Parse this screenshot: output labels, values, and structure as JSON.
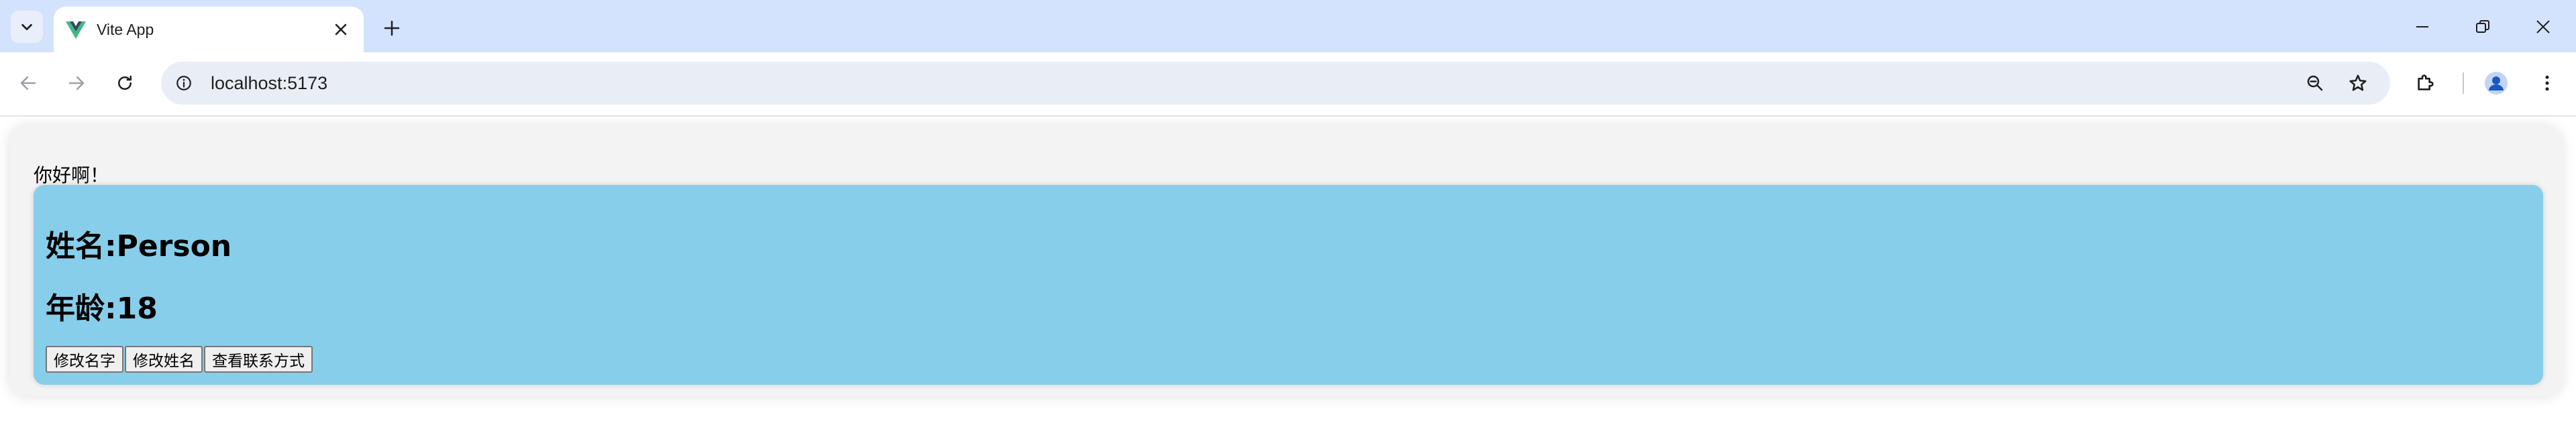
{
  "browser": {
    "tab": {
      "title": "Vite App"
    },
    "url": "localhost:5173",
    "colors": {
      "tabstrip": "#d3e3fd",
      "omnibox": "#e9eef6"
    },
    "icons": {
      "tab_list": "chevron-down-icon",
      "favicon": "vue-logo-icon",
      "tab_close": "close-icon",
      "new_tab": "plus-icon",
      "back": "arrow-left-icon",
      "forward": "arrow-right-icon",
      "reload": "reload-icon",
      "site_info": "info-icon",
      "zoom": "zoom-icon",
      "bookmark": "star-icon",
      "extensions": "puzzle-icon",
      "profile": "avatar-icon",
      "menu": "kebab-menu-icon"
    }
  },
  "page": {
    "greeting": "你好啊！",
    "name_line": "姓名:Person",
    "age_line": "年龄:18",
    "buttons": {
      "change_name": "修改名字",
      "change_surname": "修改姓名",
      "view_contact": "查看联系方式"
    },
    "colors": {
      "card_background": "#87ceeb",
      "outer_background": "#f3f3f3"
    }
  }
}
